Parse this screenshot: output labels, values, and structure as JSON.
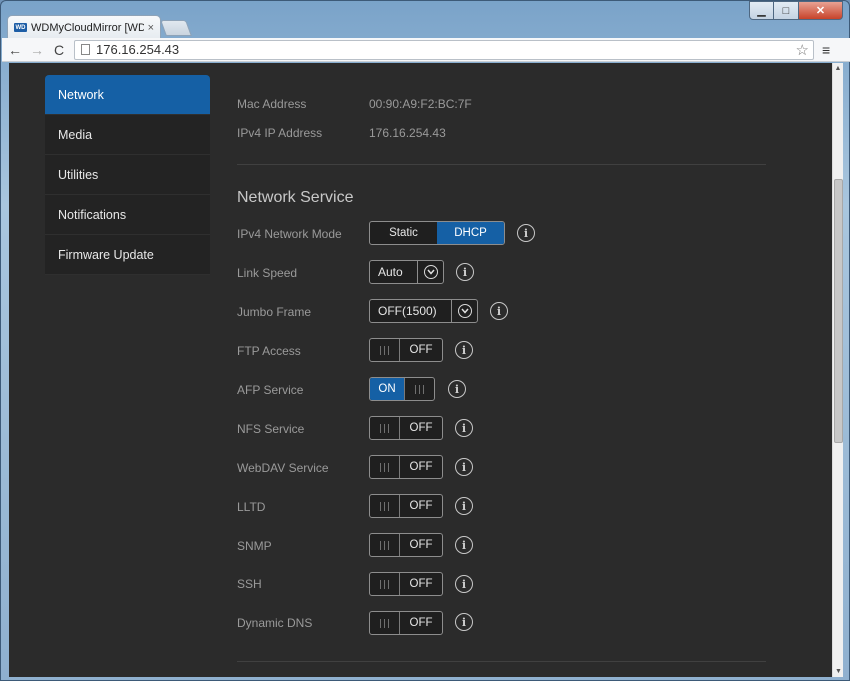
{
  "browser": {
    "tab_title": "WDMyCloudMirror [WD M",
    "tab_close": "×",
    "favicon_text": "WD",
    "url": "176.16.254.43",
    "back_glyph": "←",
    "forward_glyph": "→",
    "reload_glyph": "C",
    "star_glyph": "☆",
    "menu_glyph": "≡",
    "min_glyph": "▁",
    "max_glyph": "□",
    "close_glyph": "✕"
  },
  "sidebar": {
    "items": [
      {
        "label": "Network"
      },
      {
        "label": "Media"
      },
      {
        "label": "Utilities"
      },
      {
        "label": "Notifications"
      },
      {
        "label": "Firmware Update"
      }
    ]
  },
  "info": {
    "mac_label": "Mac Address",
    "mac_value": "00:90:A9:F2:BC:7F",
    "ipv4_label": "IPv4 IP Address",
    "ipv4_value": "176.16.254.43"
  },
  "network_service": {
    "title": "Network Service",
    "ipv4_mode_label": "IPv4 Network Mode",
    "ipv4_mode_options": [
      "Static",
      "DHCP"
    ],
    "ipv4_mode_selected": "DHCP",
    "link_speed_label": "Link Speed",
    "link_speed_value": "Auto",
    "jumbo_frame_label": "Jumbo Frame",
    "jumbo_frame_value": "OFF(1500)",
    "toggles": [
      {
        "label": "FTP Access",
        "state": "OFF"
      },
      {
        "label": "AFP Service",
        "state": "ON"
      },
      {
        "label": "NFS Service",
        "state": "OFF"
      },
      {
        "label": "WebDAV Service",
        "state": "OFF"
      },
      {
        "label": "LLTD",
        "state": "OFF"
      },
      {
        "label": "SNMP",
        "state": "OFF"
      },
      {
        "label": "SSH",
        "state": "OFF"
      },
      {
        "label": "Dynamic DNS",
        "state": "OFF"
      }
    ],
    "info_glyph": "i"
  },
  "colors": {
    "accent": "#1560a5",
    "background": "#2b2b2b"
  }
}
